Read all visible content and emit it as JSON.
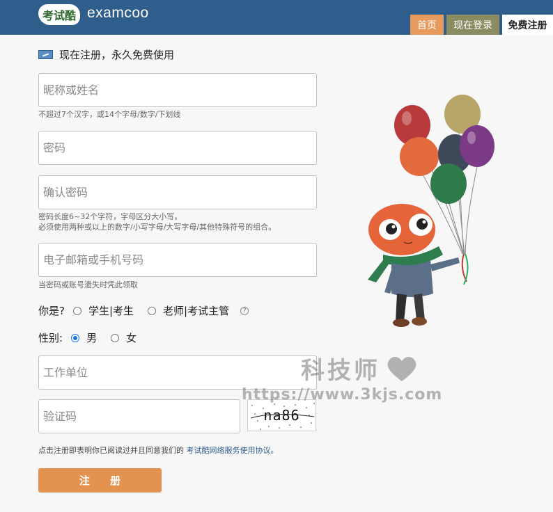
{
  "header": {
    "logo_badge": "考试酷",
    "brand": "examcoo",
    "nav": [
      "首页",
      "现在登录",
      "免费注册"
    ]
  },
  "form": {
    "title": "现在注册，永久免费使用",
    "nickname_placeholder": "昵称或姓名",
    "nickname_hint": "不超过7个汉字，或14个字母/数字/下划线",
    "password_placeholder": "密码",
    "confirm_placeholder": "确认密码",
    "password_hint_1": "密码长度6~32个字符，字母区分大小写。",
    "password_hint_2": "必须使用两种或以上的数字/小写字母/大写字母/其他特殊符号的组合。",
    "email_placeholder": "电子邮箱或手机号码",
    "email_hint": "当密码或账号遗失时凭此领取",
    "role_label": "你是?",
    "role_options": [
      "学生|考生",
      "老师|考试主管"
    ],
    "role_help": "?",
    "gender_label": "性别:",
    "gender_options": [
      "男",
      "女"
    ],
    "gender_selected": "男",
    "company_placeholder": "工作单位",
    "captcha_placeholder": "验证码",
    "captcha_text": "na86",
    "agree_text": "点击注册即表明你已阅读过并且同意我们的",
    "agree_link": "考试酷网络服务使用协议。",
    "submit_label": "注 册"
  },
  "watermark": {
    "text": "科技师",
    "url": "https://www.3kjs.com"
  },
  "icons": {
    "title": "edit-icon",
    "help": "question-circle-icon",
    "heart": "heart-icon"
  },
  "colors": {
    "header_bg": "#2f5d8c",
    "tab_home": "#e79a5d",
    "tab_login": "#8b8b62",
    "submit": "#e3924f"
  }
}
